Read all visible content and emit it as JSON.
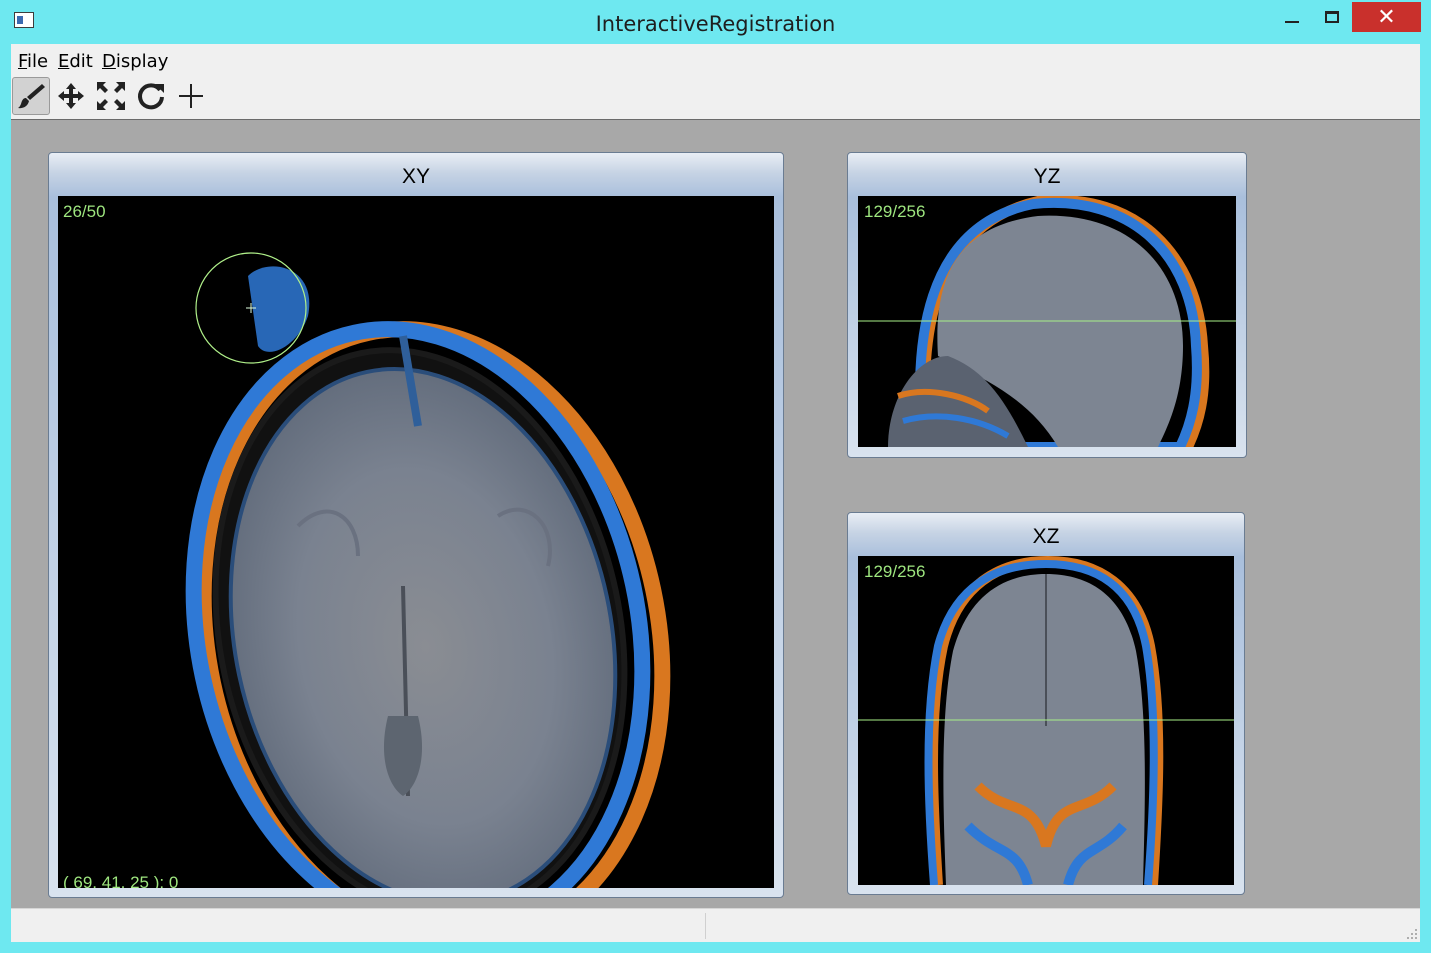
{
  "window": {
    "title": "InteractiveRegistration",
    "close_glyph": "✕"
  },
  "menu": [
    {
      "label": "File",
      "mnemonic": "F",
      "rest": "ile"
    },
    {
      "label": "Edit",
      "mnemonic": "E",
      "rest": "dit"
    },
    {
      "label": "Display",
      "mnemonic": "D",
      "rest": "isplay"
    }
  ],
  "toolbar": [
    {
      "name": "paint-brush-tool",
      "icon": "paint-brush-icon",
      "active": true
    },
    {
      "name": "translate-tool",
      "icon": "move-arrows-icon",
      "active": false
    },
    {
      "name": "scale-tool",
      "icon": "expand-arrows-icon",
      "active": false
    },
    {
      "name": "rotate-tool",
      "icon": "rotate-icon",
      "active": false
    },
    {
      "name": "add-point-tool",
      "icon": "plus-icon",
      "active": false
    }
  ],
  "views": {
    "xy": {
      "title": "XY",
      "slice": "26/50",
      "cursor": "( 69, 41, 25 ): 0"
    },
    "yz": {
      "title": "YZ",
      "slice": "129/256"
    },
    "xz": {
      "title": "XZ",
      "slice": "129/256"
    }
  },
  "colors": {
    "overlay_green": "#9ee67f",
    "fixed_blue": "#2f79d6",
    "moving_orange": "#d9771f",
    "close_red": "#c9302c"
  }
}
